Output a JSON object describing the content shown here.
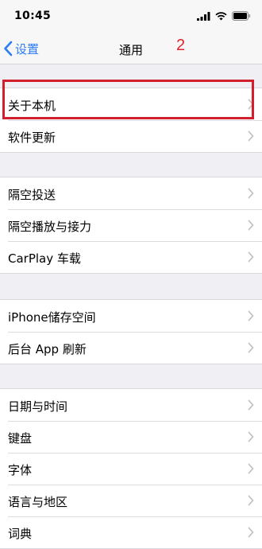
{
  "status_bar": {
    "time": "10:45",
    "icons": [
      "signal-icon",
      "wifi-icon",
      "battery-icon"
    ]
  },
  "nav": {
    "back_label": "设置",
    "title": "通用",
    "annotation": "2"
  },
  "groups": [
    {
      "items": [
        {
          "label": "关于本机"
        },
        {
          "label": "软件更新"
        }
      ]
    },
    {
      "items": [
        {
          "label": "隔空投送"
        },
        {
          "label": "隔空播放与接力"
        },
        {
          "label": "CarPlay 车载"
        }
      ]
    },
    {
      "items": [
        {
          "label": "iPhone储存空间"
        },
        {
          "label": "后台 App 刷新"
        }
      ]
    },
    {
      "items": [
        {
          "label": "日期与时间"
        },
        {
          "label": "键盘"
        },
        {
          "label": "字体"
        },
        {
          "label": "语言与地区"
        },
        {
          "label": "词典"
        }
      ]
    }
  ],
  "colors": {
    "accent": "#2c7cf6",
    "annotation": "#e0232a",
    "highlight_box": "#d21f2e",
    "background": "#efeff4"
  }
}
